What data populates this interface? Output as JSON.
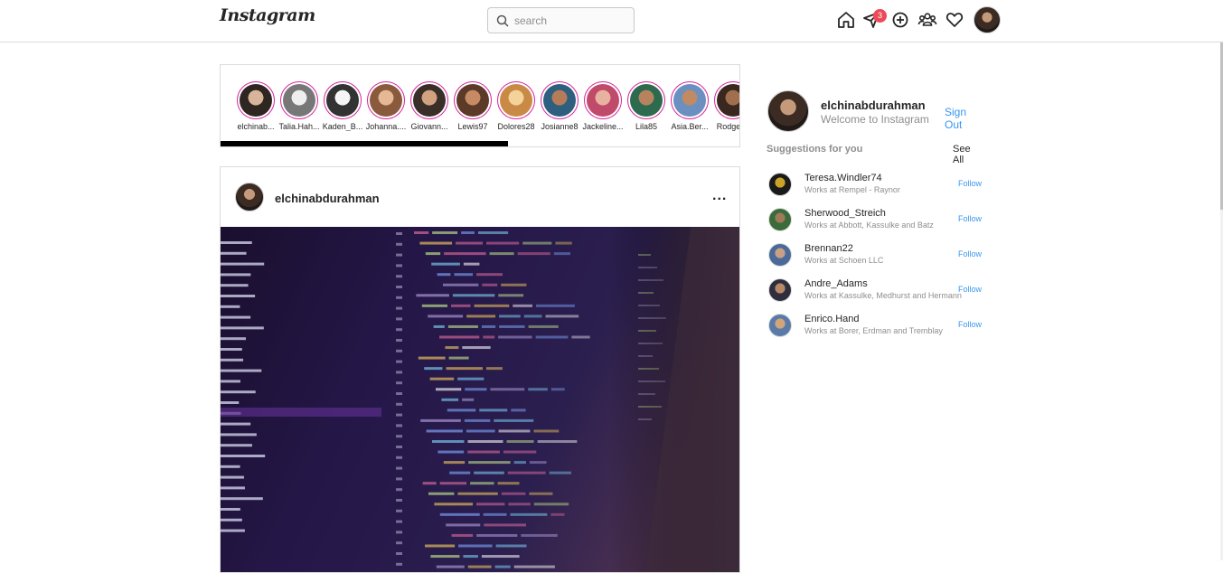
{
  "header": {
    "logo": "Instagram",
    "search_placeholder": "search",
    "messages_badge": "3"
  },
  "stories": [
    {
      "name": "elchinab...",
      "colors": [
        "#d8b49a",
        "#2f2622"
      ]
    },
    {
      "name": "Talia.Hah...",
      "colors": [
        "#eeeeee",
        "#777777"
      ]
    },
    {
      "name": "Kaden_B...",
      "colors": [
        "#f5f5f5",
        "#333333"
      ]
    },
    {
      "name": "Johanna....",
      "colors": [
        "#e6b895",
        "#8a5a3c"
      ]
    },
    {
      "name": "Giovann...",
      "colors": [
        "#d2a180",
        "#3a2f28"
      ]
    },
    {
      "name": "Lewis97",
      "colors": [
        "#c68a64",
        "#5b3a28"
      ]
    },
    {
      "name": "Dolores28",
      "colors": [
        "#f3d39a",
        "#c98a45"
      ]
    },
    {
      "name": "Josianne8",
      "colors": [
        "#b67c5a",
        "#2f5f7f"
      ]
    },
    {
      "name": "Jackeline...",
      "colors": [
        "#e7b2a0",
        "#c04a6a"
      ]
    },
    {
      "name": "Lila85",
      "colors": [
        "#b7835f",
        "#2e6a4e"
      ]
    },
    {
      "name": "Asia.Ber...",
      "colors": [
        "#c08a62",
        "#6b8fbf"
      ]
    },
    {
      "name": "Rodger...",
      "colors": [
        "#a0704e",
        "#3a2820"
      ]
    }
  ],
  "post": {
    "username": "elchinabdurahman",
    "more": "...",
    "image_alt": "code editor screenshot"
  },
  "sidebar": {
    "username": "elchinabdurahman",
    "welcome": "Welcome to Instagram",
    "signout": "Sign Out",
    "suggestions_title": "Suggestions for you",
    "see_all": "See All",
    "suggestions": [
      {
        "username": "Teresa.Windler74",
        "work": "Works at Rempel - Raynor",
        "follow": "Follow",
        "colors": [
          "#c9a227",
          "#1a1a1a"
        ]
      },
      {
        "username": "Sherwood_Streich",
        "work": "Works at Abbott, Kassulke and Batz",
        "follow": "Follow",
        "colors": [
          "#9c7a5a",
          "#3a6b3a"
        ]
      },
      {
        "username": "Brennan22",
        "work": "Works at Schoen LLC",
        "follow": "Follow",
        "colors": [
          "#c9a083",
          "#4a6a9a"
        ]
      },
      {
        "username": "Andre_Adams",
        "work": "Works at Kassulke, Medhurst and Hermann",
        "follow": "Follow",
        "colors": [
          "#b58866",
          "#2e2e3e"
        ]
      },
      {
        "username": "Enrico.Hand",
        "work": "Works at Borer, Erdman and Tremblay",
        "follow": "Follow",
        "colors": [
          "#d2a47c",
          "#5a7aa8"
        ]
      }
    ]
  },
  "colors": {
    "accent": "#3897f0",
    "badge": "#ed4956",
    "story_ring": "#d6249f",
    "border": "#dbdbdb"
  }
}
